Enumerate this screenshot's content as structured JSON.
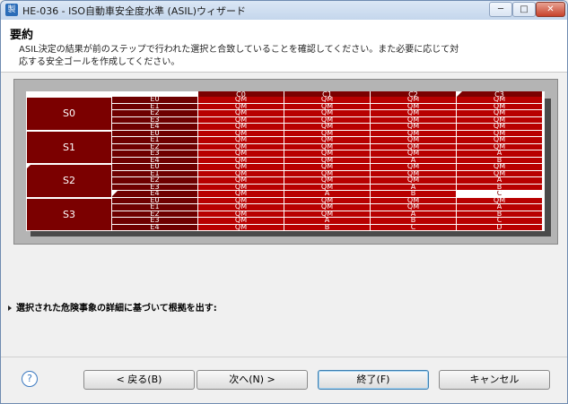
{
  "window": {
    "title": "HE-036 - ISO自動車安全度水準 (ASIL)ウィザード",
    "app_icon": "製",
    "controls": {
      "minimize": "─",
      "maximize": "□",
      "close": "✕"
    }
  },
  "header": {
    "title": "要約",
    "description": "ASIL決定の結果が前のステップで行われた選択と合致していることを確認してください。また必要に応じて対応する安全ゴールを作成してください。"
  },
  "matrix": {
    "columns": [
      "C0",
      "C1",
      "C2",
      "C3"
    ],
    "severity_rows": [
      {
        "label": "S0",
        "exposures": [
          "E0",
          "E1",
          "E2",
          "E3",
          "E4"
        ],
        "values": [
          [
            "QM",
            "QM",
            "QM",
            "QM"
          ],
          [
            "QM",
            "QM",
            "QM",
            "QM"
          ],
          [
            "QM",
            "QM",
            "QM",
            "QM"
          ],
          [
            "QM",
            "QM",
            "QM",
            "QM"
          ],
          [
            "QM",
            "QM",
            "QM",
            "QM"
          ]
        ]
      },
      {
        "label": "S1",
        "exposures": [
          "E0",
          "E1",
          "E2",
          "E3",
          "E4"
        ],
        "values": [
          [
            "QM",
            "QM",
            "QM",
            "QM"
          ],
          [
            "QM",
            "QM",
            "QM",
            "QM"
          ],
          [
            "QM",
            "QM",
            "QM",
            "QM"
          ],
          [
            "QM",
            "QM",
            "QM",
            "A"
          ],
          [
            "QM",
            "QM",
            "A",
            "B"
          ]
        ]
      },
      {
        "label": "S2",
        "exposures": [
          "E0",
          "E1",
          "E2",
          "E3",
          "E4"
        ],
        "values": [
          [
            "QM",
            "QM",
            "QM",
            "QM"
          ],
          [
            "QM",
            "QM",
            "QM",
            "QM"
          ],
          [
            "QM",
            "QM",
            "QM",
            "A"
          ],
          [
            "QM",
            "QM",
            "A",
            "B"
          ],
          [
            "QM",
            "A",
            "B",
            "C"
          ]
        ]
      },
      {
        "label": "S3",
        "exposures": [
          "E0",
          "E1",
          "E2",
          "E3",
          "E4"
        ],
        "values": [
          [
            "QM",
            "QM",
            "QM",
            "QM"
          ],
          [
            "QM",
            "QM",
            "QM",
            "A"
          ],
          [
            "QM",
            "QM",
            "A",
            "B"
          ],
          [
            "QM",
            "A",
            "B",
            "C"
          ],
          [
            "QM",
            "B",
            "C",
            "D"
          ]
        ]
      }
    ],
    "selected": {
      "severity": "S2",
      "exposure": "E4",
      "column": "C3"
    }
  },
  "expander": {
    "label": "選択された危険事象の詳細に基づいて根拠を出す:"
  },
  "footer": {
    "help_icon": "?",
    "back_label": "< 戻る(B)",
    "next_label": "次へ(N) >",
    "finish_label": "終了(F)",
    "cancel_label": "キャンセル"
  }
}
